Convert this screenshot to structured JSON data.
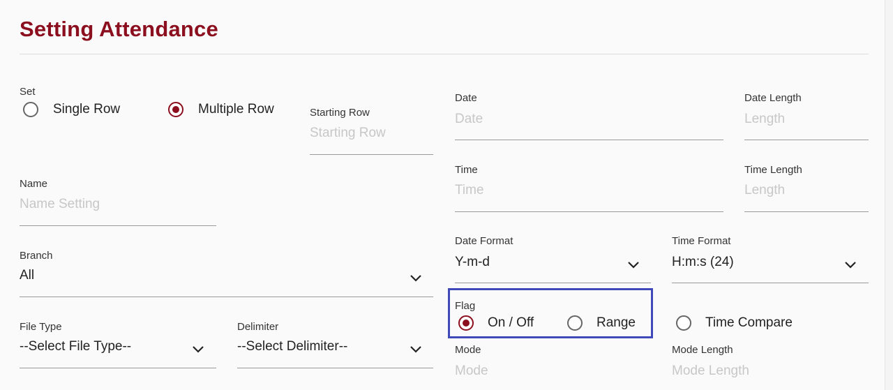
{
  "page": {
    "title": "Setting Attendance"
  },
  "set": {
    "label": "Set",
    "options": [
      {
        "label": "Single Row",
        "checked": false
      },
      {
        "label": "Multiple Row",
        "checked": true
      }
    ]
  },
  "starting_row": {
    "label": "Starting Row",
    "placeholder": "Starting Row"
  },
  "name": {
    "label": "Name",
    "placeholder": "Name Setting"
  },
  "branch": {
    "label": "Branch",
    "value": "All"
  },
  "file_type": {
    "label": "File Type",
    "value": "--Select File Type--"
  },
  "delimiter": {
    "label": "Delimiter",
    "value": "--Select Delimiter--"
  },
  "date": {
    "label": "Date",
    "placeholder": "Date"
  },
  "date_length": {
    "label": "Date Length",
    "placeholder": "Length"
  },
  "time": {
    "label": "Time",
    "placeholder": "Time"
  },
  "time_length": {
    "label": "Time Length",
    "placeholder": "Length"
  },
  "date_format": {
    "label": "Date Format",
    "value": "Y-m-d"
  },
  "time_format": {
    "label": "Time Format",
    "value": "H:m:s (24)"
  },
  "flag": {
    "label": "Flag",
    "options": [
      {
        "label": "On / Off",
        "checked": true
      },
      {
        "label": "Range",
        "checked": false
      },
      {
        "label": "Time Compare",
        "checked": false
      }
    ]
  },
  "mode": {
    "label": "Mode",
    "placeholder": "Mode"
  },
  "mode_length": {
    "label": "Mode Length",
    "placeholder": "Mode Length"
  },
  "colors": {
    "accent": "#8b0f1e",
    "highlight": "#3f49b8"
  }
}
